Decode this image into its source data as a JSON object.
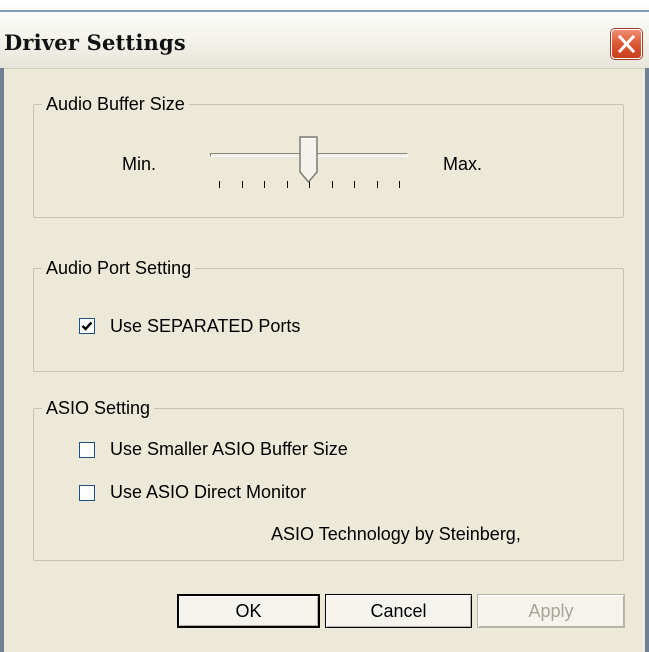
{
  "window": {
    "title": "Driver Settings"
  },
  "icons": {
    "close": "close-icon",
    "check": "checkmark-icon"
  },
  "audio_buffer": {
    "legend": "Audio Buffer Size",
    "min_label": "Min.",
    "max_label": "Max.",
    "level": 0.5,
    "tick_count": 9
  },
  "audio_port": {
    "legend": "Audio Port Setting",
    "separated_ports": {
      "label": "Use SEPARATED Ports",
      "checked": true
    }
  },
  "asio": {
    "legend": "ASIO Setting",
    "smaller_buffer": {
      "label": "Use Smaller ASIO Buffer Size",
      "checked": false
    },
    "direct_monitor": {
      "label": "Use ASIO Direct Monitor",
      "checked": false
    },
    "credit": "ASIO Technology by Steinberg,"
  },
  "buttons": {
    "ok": "OK",
    "cancel": "Cancel",
    "apply": "Apply"
  },
  "colors": {
    "close_button": "#d9542f",
    "frame": "#6f7f96",
    "face": "#ece9d8"
  }
}
